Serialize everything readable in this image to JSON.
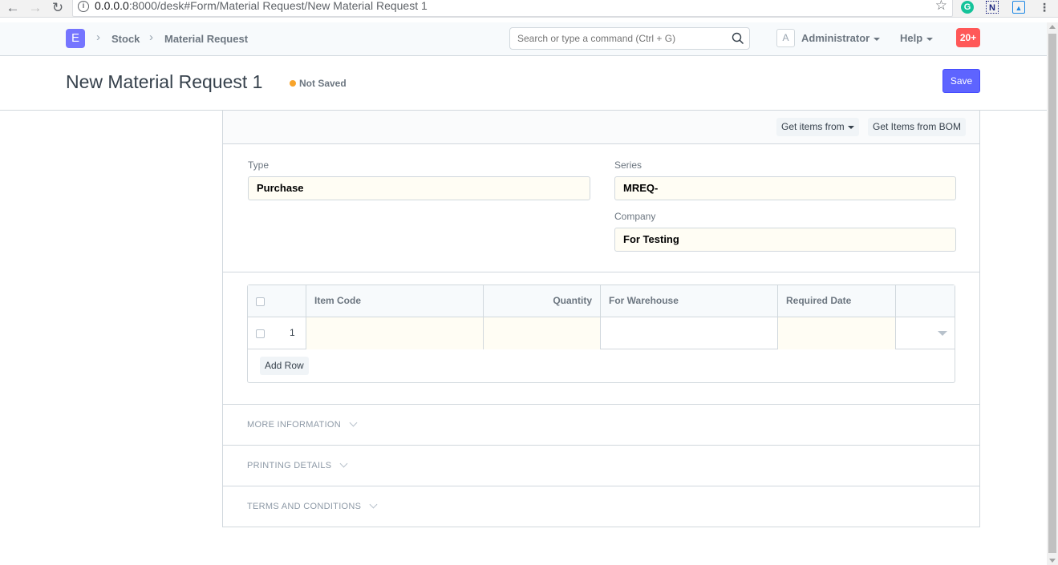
{
  "browser": {
    "url_host": "0.0.0.0",
    "url_rest": ":8000/desk#Form/Material Request/New Material Request 1"
  },
  "navbar": {
    "logo_letter": "E",
    "breadcrumbs": [
      "Stock",
      "Material Request"
    ],
    "search_placeholder": "Search or type a command (Ctrl + G)",
    "avatar_letter": "A",
    "user_label": "Administrator",
    "help_label": "Help",
    "notification_count": "20+"
  },
  "page": {
    "title": "New Material Request 1",
    "status": "Not Saved",
    "save_label": "Save"
  },
  "toolbar": {
    "get_items_from": "Get items from",
    "get_items_bom": "Get Items from BOM"
  },
  "fields": {
    "type_label": "Type",
    "type_value": "Purchase",
    "series_label": "Series",
    "series_value": "MREQ-",
    "company_label": "Company",
    "company_value": "For Testing"
  },
  "items_table": {
    "columns": [
      "Item Code",
      "Quantity",
      "For Warehouse",
      "Required Date"
    ],
    "rows": [
      {
        "idx": "1",
        "item_code": "",
        "quantity": "",
        "warehouse": "",
        "required_date": ""
      }
    ],
    "add_row_label": "Add Row"
  },
  "sections": [
    "MORE INFORMATION",
    "PRINTING DETAILS",
    "TERMS AND CONDITIONS"
  ],
  "colors": {
    "primary": "#5e64ff",
    "indicator_orange": "#f8a42b",
    "badge_red": "#ff5858",
    "input_bg": "#fffdf4"
  }
}
